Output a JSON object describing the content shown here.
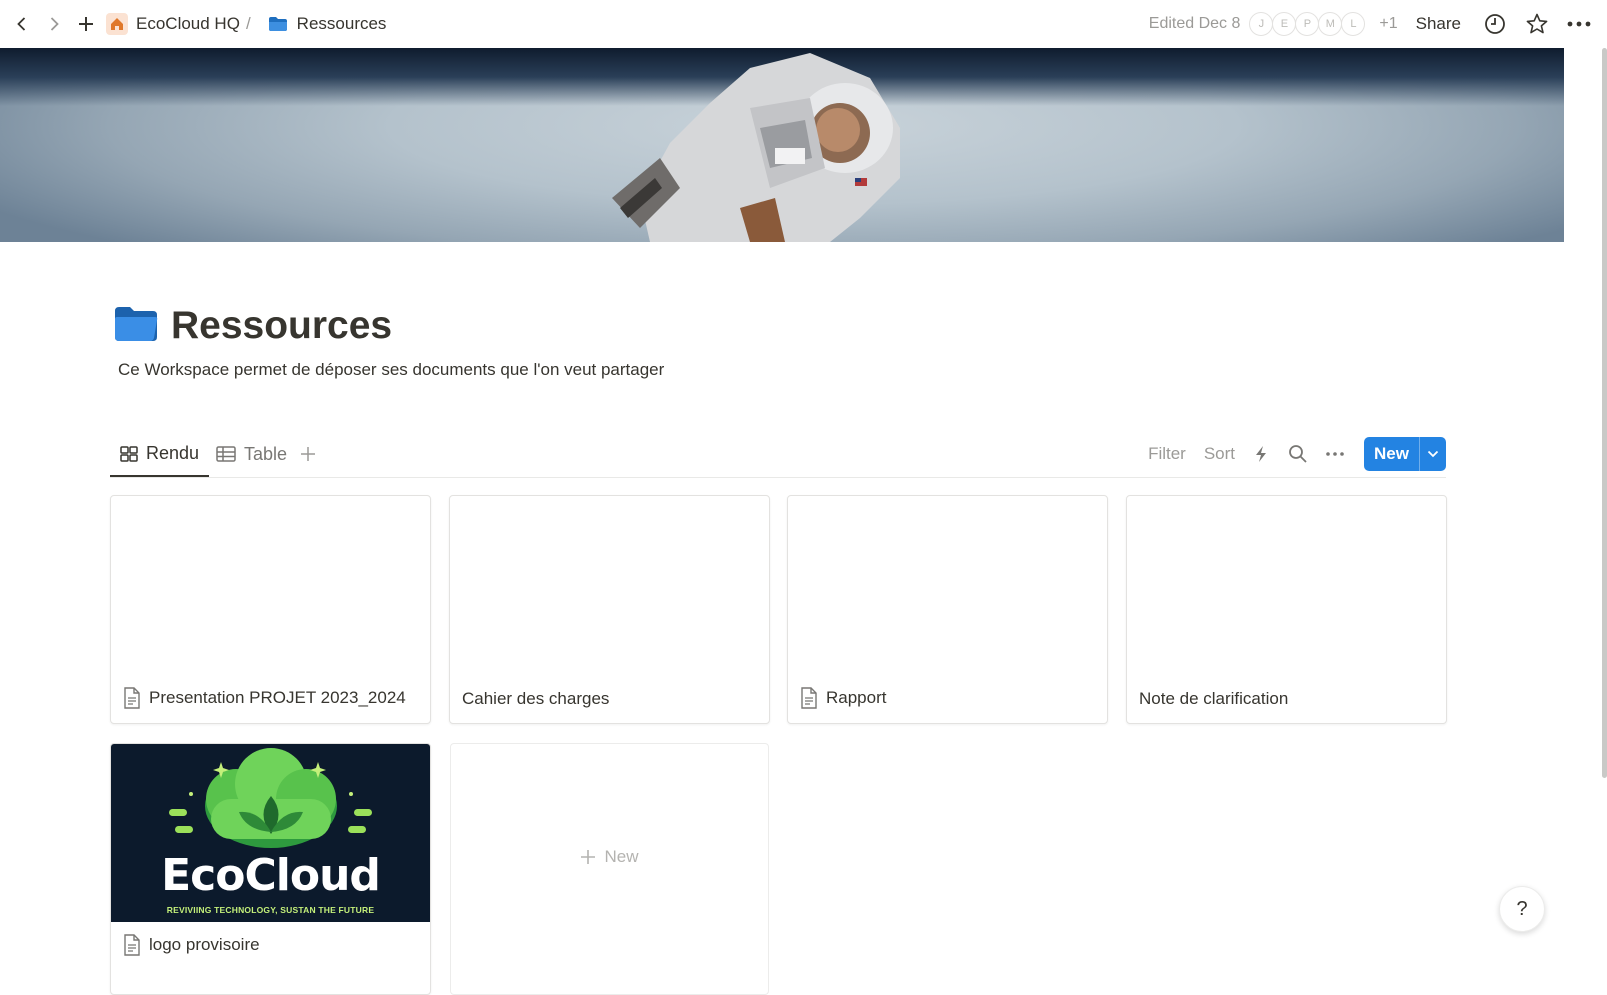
{
  "topbar": {
    "workspace_name": "EcoCloud HQ",
    "separator": "/",
    "page_name": "Ressources",
    "edited": "Edited Dec 8",
    "avatars": [
      "J",
      "E",
      "P",
      "M",
      "L"
    ],
    "avatars_more": "+1",
    "share_label": "Share"
  },
  "page": {
    "title": "Ressources",
    "description": "Ce Workspace permet de déposer ses documents que l'on veut partager",
    "icon": "folder-icon"
  },
  "views": {
    "tabs": [
      {
        "label": "Rendu",
        "icon": "gallery-icon",
        "active": true
      },
      {
        "label": "Table",
        "icon": "table-icon",
        "active": false
      }
    ],
    "filter_label": "Filter",
    "sort_label": "Sort",
    "new_label": "New"
  },
  "cards": [
    {
      "title": "Presentation PROJET 2023_2024",
      "has_doc_icon": true
    },
    {
      "title": "Cahier des charges",
      "has_doc_icon": false
    },
    {
      "title": "Rapport",
      "has_doc_icon": true
    },
    {
      "title": "Note de clarification",
      "has_doc_icon": false
    },
    {
      "title": "logo provisoire",
      "has_doc_icon": true
    }
  ],
  "logo_image": {
    "brand": "EcoCloud",
    "tagline": "REVIVIING TECHNOLOGY, SUSTAN THE FUTURE"
  },
  "new_card_label": "New",
  "help_label": "?",
  "colors": {
    "accent": "#2383e2",
    "text": "#37352f",
    "muted": "#9b9a97"
  }
}
